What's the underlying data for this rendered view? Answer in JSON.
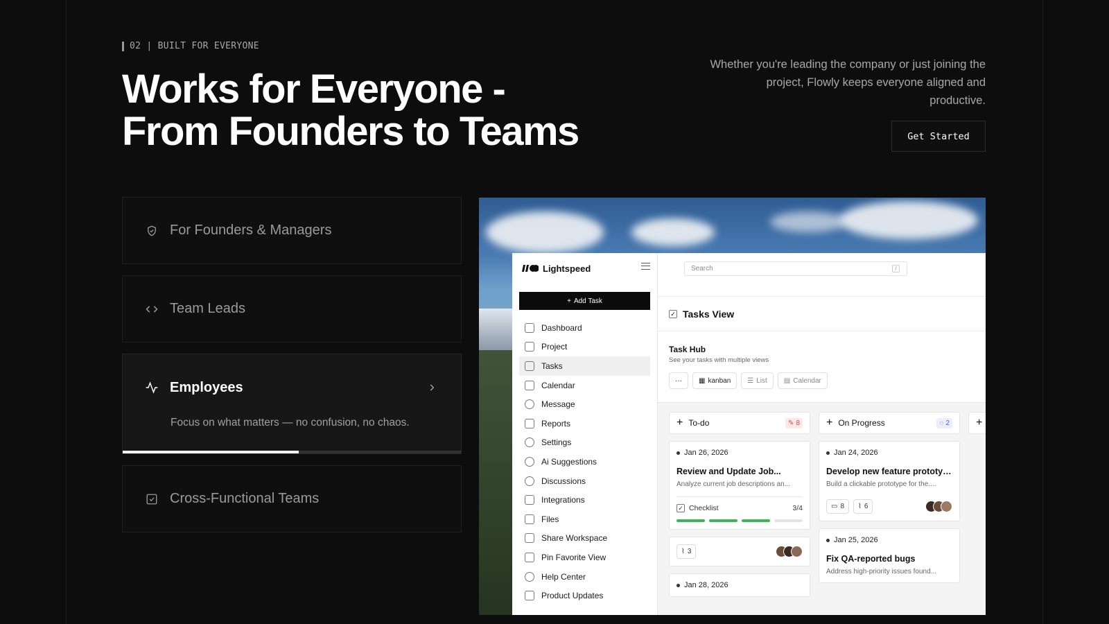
{
  "header": {
    "eyebrow": "02 | BUILT FOR EVERYONE",
    "title_line1": "Works for Everyone -",
    "title_line2": "From Founders to Teams",
    "lead": "Whether you're leading the company or just joining the project, Flowly keeps everyone aligned and productive.",
    "cta_label": "Get Started"
  },
  "audiences": [
    {
      "label": "For Founders & Managers",
      "icon": "shield-check-icon"
    },
    {
      "label": "Team Leads",
      "icon": "code-icon"
    },
    {
      "label": "Employees",
      "icon": "activity-icon",
      "description": "Focus on what matters — no confusion, no chaos.",
      "progress": 0.52
    },
    {
      "label": "Cross-Functional Teams",
      "icon": "checkbox-icon"
    }
  ],
  "app": {
    "brand": "Lightspeed",
    "add_task": "Add Task",
    "search_placeholder": "Search",
    "search_shortcut": "/",
    "nav": [
      "Dashboard",
      "Project",
      "Tasks",
      "Calendar",
      "Message",
      "Reports",
      "Settings",
      "Ai Suggestions",
      "Discussions",
      "Integrations",
      "Files",
      "Share Workspace",
      "Pin Favorite View",
      "Help Center",
      "Product Updates"
    ],
    "selected_nav": "Tasks",
    "view_title": "Tasks View",
    "hub_title": "Task Hub",
    "hub_subtitle": "See your tasks with multiple views",
    "views": {
      "more": "···",
      "kanban": "kanban",
      "list": "List",
      "calendar": "Calendar"
    },
    "columns": [
      {
        "title": "To-do",
        "count": "8",
        "count_color": "#e04848",
        "cards": [
          {
            "date": "Jan 26, 2026",
            "title": "Review and Update Job...",
            "desc": "Analyze current job descriptions an...",
            "checklist_label": "Checklist",
            "checklist_value": "3/4",
            "checklist_done": 3,
            "checklist_total": 4,
            "attachments": "3"
          },
          {
            "date": "Jan 28, 2026"
          }
        ]
      },
      {
        "title": "On Progress",
        "count": "2",
        "count_color": "#5b5bd6",
        "cards": [
          {
            "date": "Jan 24, 2026",
            "title": "Develop new feature prototype",
            "desc": "Build a clickable prototype for the....",
            "comments": "8",
            "attachments": "6"
          },
          {
            "date": "Jan 25, 2026",
            "title": "Fix QA-reported bugs",
            "desc": "Address high-priority issues found..."
          }
        ]
      }
    ]
  }
}
